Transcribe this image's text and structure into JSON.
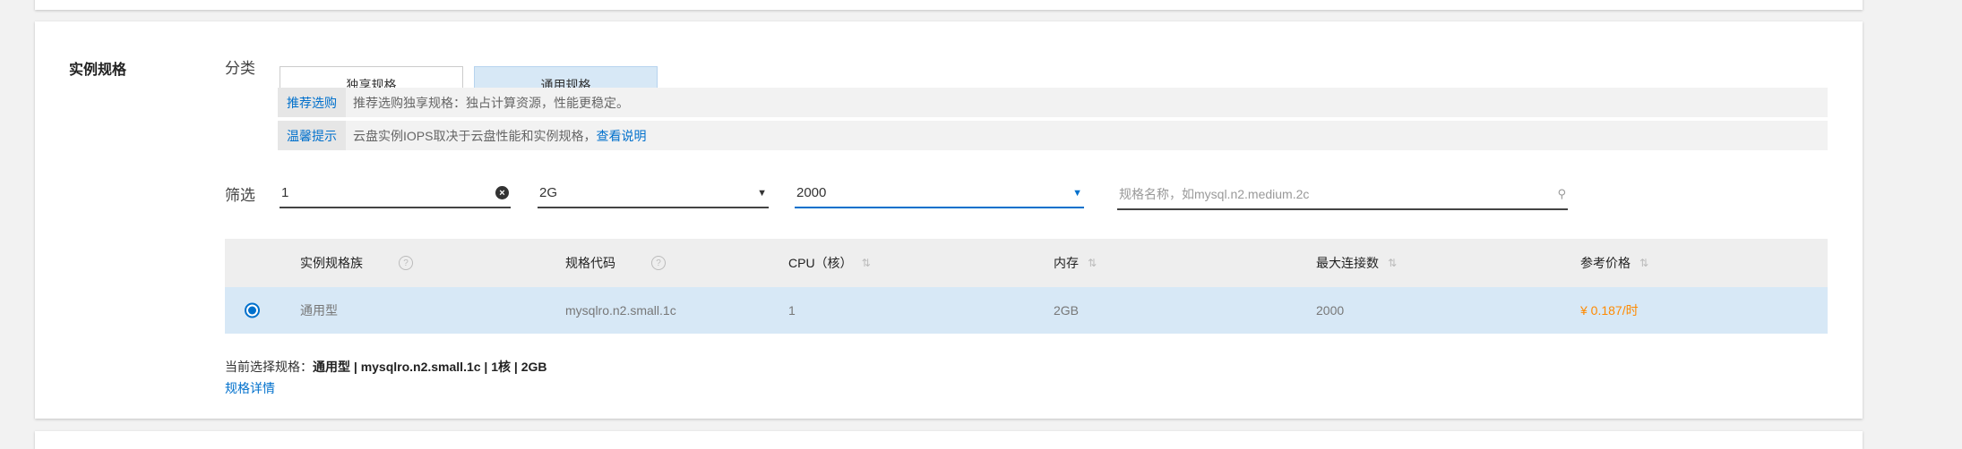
{
  "section_title": "实例规格",
  "category": {
    "label": "分类",
    "options": [
      "独享规格",
      "通用规格"
    ],
    "selected": "通用规格"
  },
  "tips": [
    {
      "label": "推荐选购",
      "text": "推荐选购独享规格：独占计算资源，性能更稳定。",
      "link": ""
    },
    {
      "label": "温馨提示",
      "text": "云盘实例IOPS取决于云盘性能和实例规格，",
      "link": "查看说明"
    }
  ],
  "filter": {
    "label": "筛选",
    "cpu_value": "1",
    "memory_value": "2G",
    "connections_value": "2000",
    "search_placeholder": "规格名称，如mysql.n2.medium.2c"
  },
  "table": {
    "headers": [
      "实例规格族",
      "规格代码",
      "CPU（核）",
      "内存",
      "最大连接数",
      "参考价格"
    ],
    "rows": [
      {
        "selected": true,
        "family": "通用型",
        "code": "mysqlro.n2.small.1c",
        "cpu": "1",
        "memory": "2GB",
        "max_connections": "2000",
        "price": "¥ 0.187/时"
      }
    ]
  },
  "summary": {
    "label": "当前选择规格：",
    "value": "通用型 | mysqlro.n2.small.1c | 1核 | 2GB",
    "details_link": "规格详情"
  },
  "colors": {
    "accent": "#0070cc",
    "price": "#ff8a00",
    "selected_bg": "#d7e8f6"
  }
}
